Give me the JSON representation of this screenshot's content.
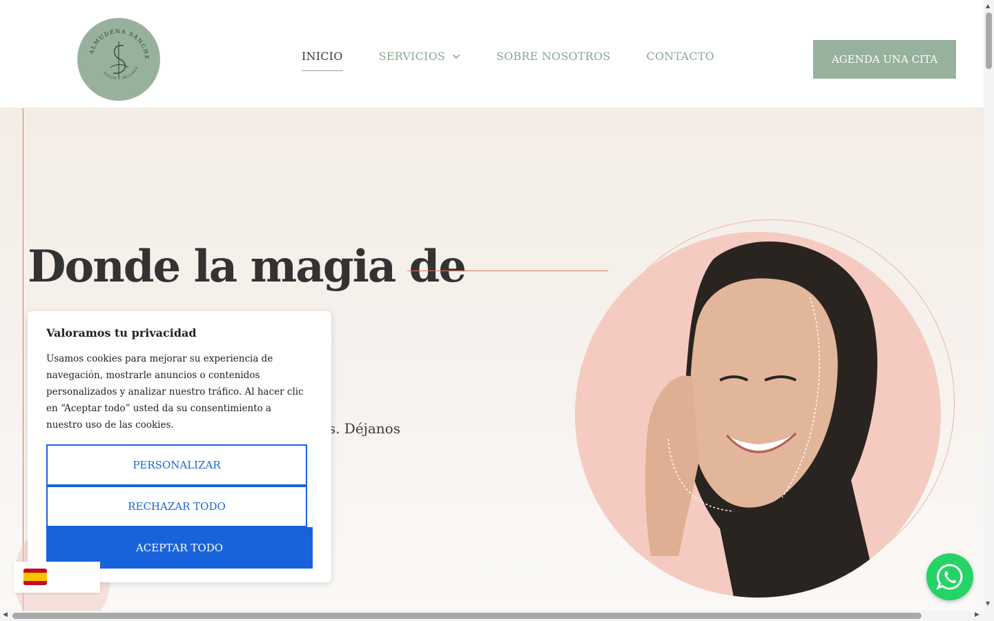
{
  "header": {
    "logo_text": "ALMUDENA SÁNCHEZ",
    "logo_subtext": "SALUD Y BELLEZA",
    "nav": [
      {
        "label": "INICIO",
        "active": true
      },
      {
        "label": "SERVICIOS",
        "has_dropdown": true
      },
      {
        "label": "SOBRE NOSOTROS"
      },
      {
        "label": "CONTACTO"
      }
    ],
    "cta_label": "AGENDA UNA CITA"
  },
  "hero": {
    "title": "Donde la magia de",
    "text_fragment": "s. Déjanos"
  },
  "cookie": {
    "title": "Valoramos tu privacidad",
    "body": "Usamos cookies para mejorar su experiencia de navegación, mostrarle anuncios o contenidos personalizados y analizar nuestro tráfico. Al hacer clic en “Aceptar todo” usted da su consentimiento a nuestro uso de las cookies.",
    "customize_label": "PERSONALIZAR",
    "reject_label": "RECHAZAR TODO",
    "accept_label": "ACEPTAR TODO"
  },
  "colors": {
    "brand_green": "#97b19c",
    "accent_coral": "#d97a5a",
    "cookie_blue": "#1863dc",
    "whatsapp_green": "#25d366",
    "portrait_pink": "#f5cbc1"
  },
  "icons": {
    "dropdown": "chevron-down-icon",
    "whatsapp": "whatsapp-icon",
    "language": "spain-flag-icon"
  }
}
